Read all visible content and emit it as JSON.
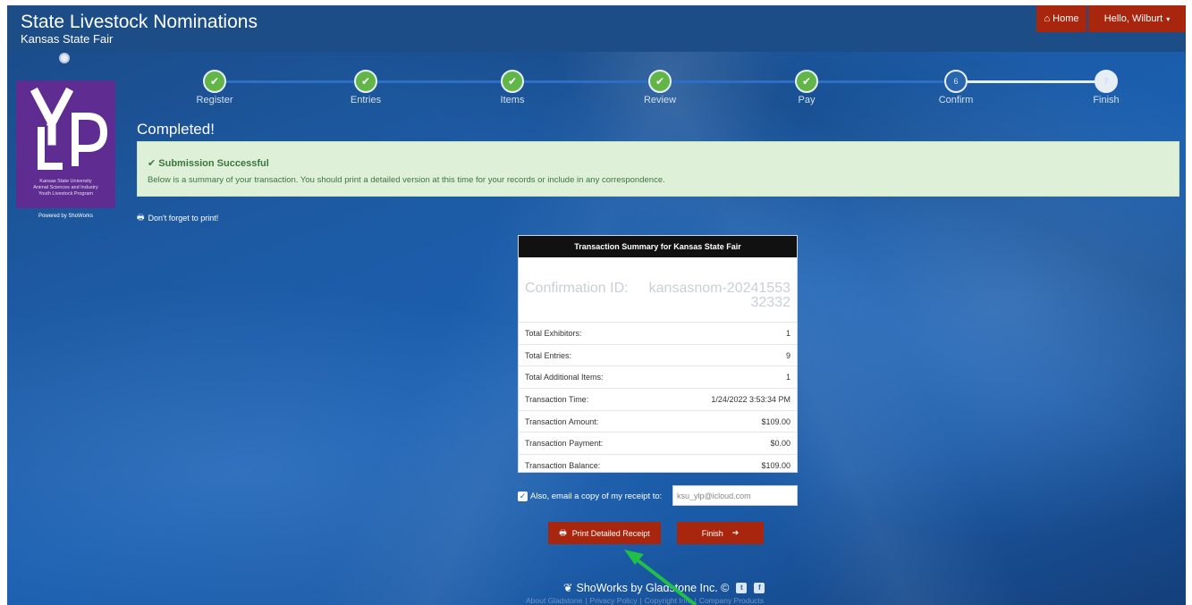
{
  "header": {
    "title": "State Livestock Nominations",
    "subtitle": "Kansas State Fair",
    "home_label": "Home",
    "user_label": "Hello, Wilburt"
  },
  "sidebar": {
    "logo_text": "LYP",
    "logo_lines": [
      "Kansas State University",
      "Animal Sciences and Industry",
      "Youth Livestock Program"
    ],
    "powered_by": "Powered by ShoWorks"
  },
  "wizard": {
    "steps": [
      {
        "label": "Register",
        "state": "done"
      },
      {
        "label": "Entries",
        "state": "done"
      },
      {
        "label": "Items",
        "state": "done"
      },
      {
        "label": "Review",
        "state": "done"
      },
      {
        "label": "Pay",
        "state": "done"
      },
      {
        "label": "Confirm",
        "state": "number",
        "number": "6"
      },
      {
        "label": "Finish",
        "state": "active",
        "number": "7"
      }
    ]
  },
  "status": {
    "heading": "Completed!",
    "alert_title": "Submission Successful",
    "alert_text": "Below is a summary of your transaction. You should print a detailed version at this time for your records or include in any correspondence.",
    "print_reminder": "Don't forget to print!"
  },
  "summary": {
    "title": "Transaction Summary for Kansas State Fair",
    "confirmation_label": "Confirmation ID:",
    "confirmation_id": "kansasnom-2024155332332",
    "rows": [
      {
        "label": "Total Exhibitors:",
        "value": "1"
      },
      {
        "label": "Total Entries:",
        "value": "9"
      },
      {
        "label": "Total Additional Items:",
        "value": "1"
      },
      {
        "label": "Transaction Time:",
        "value": "1/24/2022 3:53:34 PM"
      },
      {
        "label": "Transaction Amount:",
        "value": "$109.00"
      },
      {
        "label": "Transaction Payment:",
        "value": "$0.00"
      },
      {
        "label": "Transaction Balance:",
        "value": "$109.00"
      }
    ]
  },
  "email": {
    "checked": true,
    "label": "Also, email a copy of my receipt to:",
    "value": "ksu_ylp@icloud.com"
  },
  "actions": {
    "print_label": "Print Detailed Receipt",
    "finish_label": "Finish"
  },
  "footer": {
    "brand": "ShoWorks by Gladstone Inc. ©",
    "links": [
      "About Gladstone",
      "|",
      "Privacy Policy",
      "|",
      "Copyright Info",
      "|",
      "Company Products"
    ]
  },
  "colors": {
    "header_bg": "#1d4d86",
    "button_red": "#a8260d",
    "success_green": "#62b547",
    "alert_bg": "#dff0d8",
    "logo_purple": "#5f2c91",
    "annotation_arrow": "#1fbf4a"
  },
  "icons": [
    "home-icon",
    "caret-down-icon",
    "check-icon",
    "print-icon",
    "arrow-right-icon",
    "leaf-icon",
    "twitter-icon",
    "facebook-icon"
  ]
}
